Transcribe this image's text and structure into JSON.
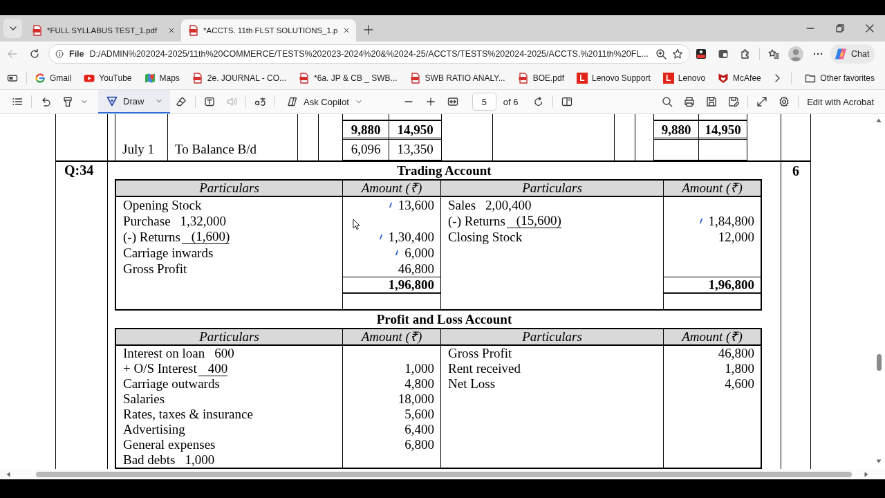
{
  "browser": {
    "tabs": [
      {
        "title": "*FULL SYLLABUS TEST_1.pdf",
        "selected": false
      },
      {
        "title": "*ACCTS. 11th FLST SOLUTIONS_1.p",
        "selected": true
      }
    ],
    "address_bar": {
      "back_disabled": true,
      "scheme": "File",
      "url": "D:/ADMIN%202024-2025/11th%20COMMERCE/TESTS%202023-2024%20&%2024-25/ACCTS/TESTS%202024-2025/ACCTS.%2011th%20FL..."
    },
    "chat_button": "Chat",
    "favorites": [
      {
        "label": "Gmail",
        "kind": "google"
      },
      {
        "label": "YouTube",
        "kind": "youtube"
      },
      {
        "label": "Maps",
        "kind": "maps"
      },
      {
        "label": "2e. JOURNAL - CO...",
        "kind": "pdf"
      },
      {
        "label": "*6a. JP & CB _ SWB...",
        "kind": "pdf"
      },
      {
        "label": "SWB RATIO ANALY...",
        "kind": "pdf"
      },
      {
        "label": "BOE.pdf",
        "kind": "pdf"
      },
      {
        "label": "Lenovo Support",
        "kind": "lenovo",
        "badge": "L"
      },
      {
        "label": "Lenovo",
        "kind": "lenovo",
        "badge": "L"
      },
      {
        "label": "McAfee",
        "kind": "mcafee"
      }
    ],
    "other_favorites": "Other favorites"
  },
  "pdf_toolbar": {
    "draw": {
      "label": "Draw",
      "selected": true
    },
    "read_aloud_disabled": true,
    "ask_copilot": "Ask Copilot",
    "page": {
      "value": "5",
      "total": "of 6"
    },
    "edit_button": "Edit with Acrobat"
  },
  "document": {
    "ledger_fragment": {
      "rows": [
        {
          "kind": "total",
          "debit_amounts": [
            "9,880",
            "14,950"
          ],
          "credit_amounts": [
            "9,880",
            "14,950"
          ]
        },
        {
          "kind": "entry",
          "date": "July 1",
          "particulars": "To Balance B/d",
          "debit_amounts": [
            "6,096",
            "13,350"
          ]
        }
      ]
    },
    "question": {
      "number": "Q:34",
      "marks": "6",
      "accounts": [
        {
          "title": "Trading Account",
          "columns": [
            "Particulars",
            "Amount (₹)",
            "Particulars",
            "Amount (₹)"
          ],
          "debit": [
            {
              "label": "Opening Stock",
              "amount": "13,600",
              "ink_mark": true
            },
            {
              "label": "Purchase",
              "inner": "1,32,000",
              "inner_underlined": false,
              "ink_mark": false
            },
            {
              "label": "(-) Returns",
              "inner": "(1,600)",
              "inner_underlined": true,
              "amount": "1,30,400",
              "ink_mark": true
            },
            {
              "label": "Carriage inwards",
              "amount": "6,000",
              "ink_mark": true
            },
            {
              "label": "Gross Profit",
              "amount": "46,800",
              "ink_mark": false
            }
          ],
          "credit": [
            {
              "label": "Sales",
              "inner": "2,00,400",
              "inner_underlined": false,
              "ink_mark": false
            },
            {
              "label": "(-) Returns",
              "inner": "(15,600)",
              "inner_underlined": true,
              "amount": "1,84,800",
              "ink_mark": true
            },
            {
              "label": "Closing Stock",
              "amount": "12,000",
              "ink_mark": false
            }
          ],
          "totals": [
            "1,96,800",
            "1,96,800"
          ]
        },
        {
          "title": "Profit and Loss Account",
          "columns": [
            "Particulars",
            "Amount (₹)",
            "Particulars",
            "Amount (₹)"
          ],
          "debit": [
            {
              "label": "Interest on loan",
              "inner": "600",
              "inner_underlined": false
            },
            {
              "label": "+ O/S Interest",
              "inner": "400",
              "inner_underlined": true,
              "amount": "1,000"
            },
            {
              "label": "Carriage outwards",
              "amount": "4,800"
            },
            {
              "label": "Salaries",
              "amount": "18,000"
            },
            {
              "label": "Rates, taxes & insurance",
              "amount": "5,600"
            },
            {
              "label": "Advertising",
              "amount": "6,400"
            },
            {
              "label": "General expenses",
              "amount": "6,800"
            },
            {
              "label": "Bad debts",
              "inner": "1,000",
              "inner_underlined": false
            }
          ],
          "credit": [
            {
              "label": "Gross Profit",
              "amount": "46,800"
            },
            {
              "label": "Rent received",
              "amount": "1,800"
            },
            {
              "label": "Net Loss",
              "amount": "4,600"
            }
          ]
        }
      ]
    }
  }
}
